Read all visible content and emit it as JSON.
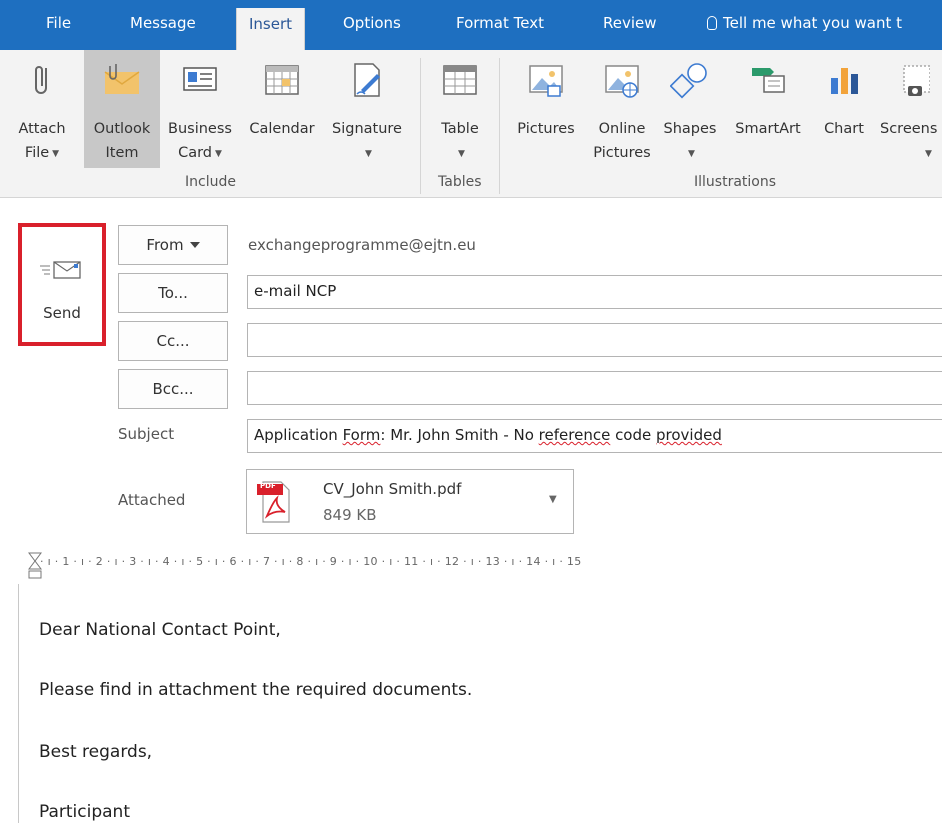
{
  "tabs": {
    "file": "File",
    "message": "Message",
    "insert": "Insert",
    "options": "Options",
    "format_text": "Format Text",
    "review": "Review",
    "tell_me": "Tell me what you want t"
  },
  "ribbon": {
    "attach_file": [
      "Attach",
      "File"
    ],
    "outlook_item": [
      "Outlook",
      "Item"
    ],
    "business_card": [
      "Business",
      "Card"
    ],
    "calendar": "Calendar",
    "signature": "Signature",
    "table": "Table",
    "pictures": "Pictures",
    "online_pictures": [
      "Online",
      "Pictures"
    ],
    "shapes": "Shapes",
    "smartart": "SmartArt",
    "chart": "Chart",
    "screenshot": "Screens",
    "groups": {
      "include": "Include",
      "tables": "Tables",
      "illustrations": "Illustrations"
    }
  },
  "compose": {
    "send_label": "Send",
    "from_label": "From",
    "from_address": "exchangeprogramme@ejtn.eu",
    "to_label": "To...",
    "to_value": "e-mail NCP",
    "cc_label": "Cc...",
    "bcc_label": "Bcc...",
    "subject_label": "Subject",
    "subject_parts": {
      "p1": "Application ",
      "p2": "Form",
      "p3": ": Mr. John Smith - No ",
      "p4": "reference",
      "p5": " code ",
      "p6": "provided"
    },
    "attached_label": "Attached",
    "attachment": {
      "name": "CV_John Smith.pdf",
      "size": "849 KB",
      "badge": "PDF"
    }
  },
  "ruler": {
    "text": "· ı · 1 · ı · 2 · ı · 3 · ı · 4 · ı · 5 · ı · 6 · ı · 7 · ı · 8 · ı · 9 · ı · 10 · ı · 11 · ı · 12 · ı · 13 · ı · 14 · ı · 15"
  },
  "body": {
    "greeting": "Dear National Contact Point,",
    "line1": "Please find in attachment the required documents.",
    "closing": "Best regards,",
    "signature": "Participant"
  },
  "colors": {
    "tab_bar": "#1e6fc0",
    "ribbon_bg": "#f3f3f3",
    "highlight_box": "#d9202b"
  }
}
